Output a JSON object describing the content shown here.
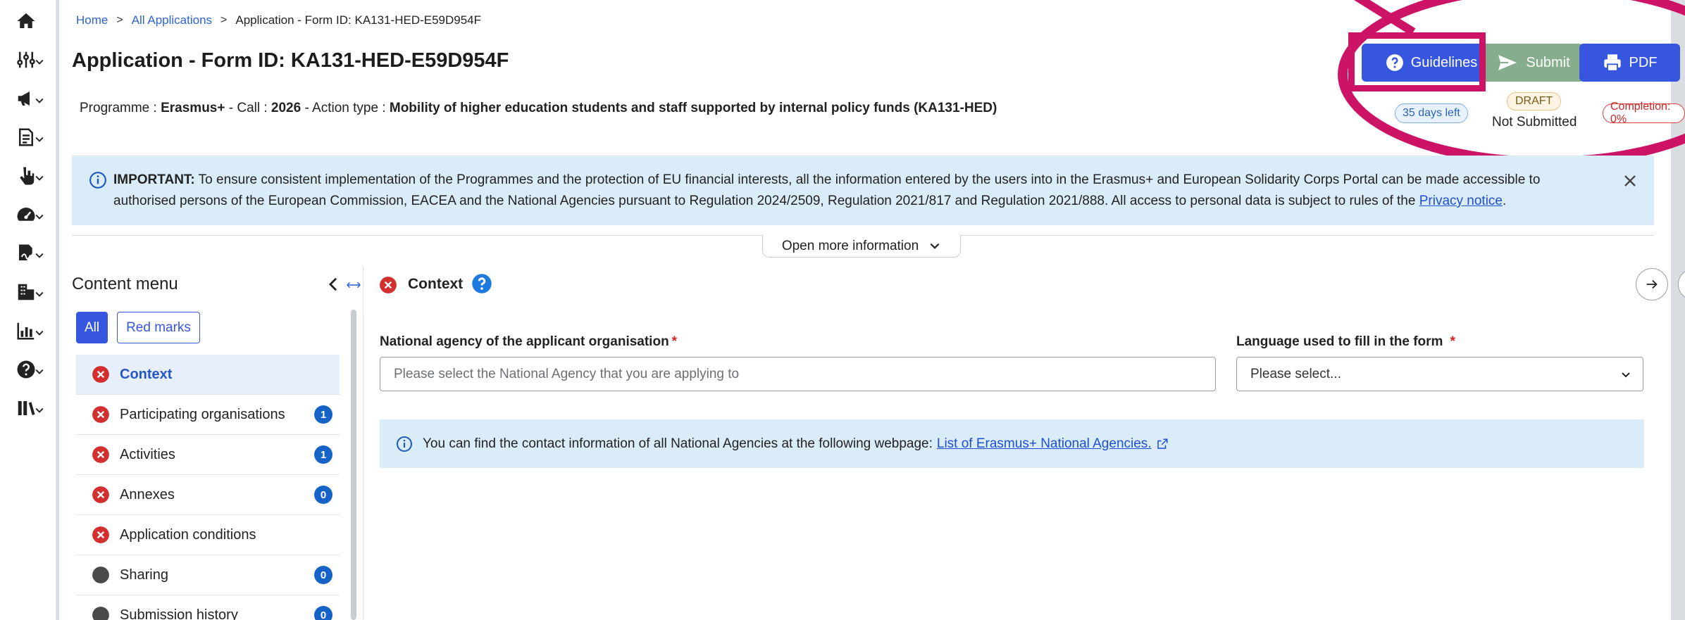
{
  "breadcrumb": {
    "home": "Home",
    "all_applications": "All Applications",
    "current": "Application - Form ID: KA131-HED-E59D954F"
  },
  "header": {
    "title": "Application - Form ID: KA131-HED-E59D954F",
    "programme_label": "Programme : ",
    "programme_value": "Erasmus+",
    "call_label": " - Call : ",
    "call_value": "2026",
    "action_label": " - Action type : ",
    "action_value": "Mobility of higher education students and staff supported by internal policy funds (KA131-HED)"
  },
  "actions": {
    "guidelines_label": "Guidelines",
    "submit_label": "Submit",
    "pdf_label": "PDF"
  },
  "status": {
    "days_left": "35 days left",
    "draft": "DRAFT",
    "submission_status": "Not Submitted",
    "completion": "Completion: 0%"
  },
  "banner": {
    "important_label": "IMPORTANT:",
    "text": " To ensure consistent implementation of the Programmes and the protection of EU financial interests, all the information entered by the users into in the Erasmus+ and European Solidarity Corps Portal can be made accessible to authorised persons of the European Commission, EACEA and the National Agencies pursuant to Regulation 2024/2509, Regulation 2021/817 and Regulation 2021/888. All access to personal data is subject to rules of the ",
    "link": "Privacy notice",
    "end": "."
  },
  "more_info_label": "Open more information",
  "content_menu": {
    "title": "Content menu",
    "filter_all": "All",
    "filter_red": "Red marks",
    "items": [
      {
        "label": "Context",
        "status": "error",
        "count": ""
      },
      {
        "label": "Participating organisations",
        "status": "error",
        "count": "1"
      },
      {
        "label": "Activities",
        "status": "error",
        "count": "1"
      },
      {
        "label": "Annexes",
        "status": "error",
        "count": "0"
      },
      {
        "label": "Application conditions",
        "status": "error",
        "count": ""
      },
      {
        "label": "Sharing",
        "status": "neutral",
        "count": "0"
      },
      {
        "label": "Submission history",
        "status": "neutral",
        "count": "0"
      }
    ]
  },
  "section": {
    "title": "Context",
    "agency_label": "National agency of the applicant organisation",
    "agency_placeholder": "Please select the National Agency that you are applying to",
    "language_label": "Language used to fill in the form",
    "language_value": "Please select...",
    "required_mark": "*",
    "info_text": "You can find the contact information of all National Agencies at the following webpage:",
    "info_link": "List of Erasmus+ National Agencies."
  },
  "colors": {
    "primary": "#3756e0",
    "submit": "#87ae8c",
    "highlight": "#cc1366",
    "error": "#d32f2f",
    "info_bg": "#dbecf9"
  },
  "rail_icons": [
    "home-icon",
    "sliders-icon",
    "megaphone-icon",
    "document-edit-icon",
    "hand-pointer-icon",
    "dashboard-icon",
    "signature-icon",
    "building-icon",
    "bar-chart-icon",
    "help-icon",
    "library-icon"
  ]
}
